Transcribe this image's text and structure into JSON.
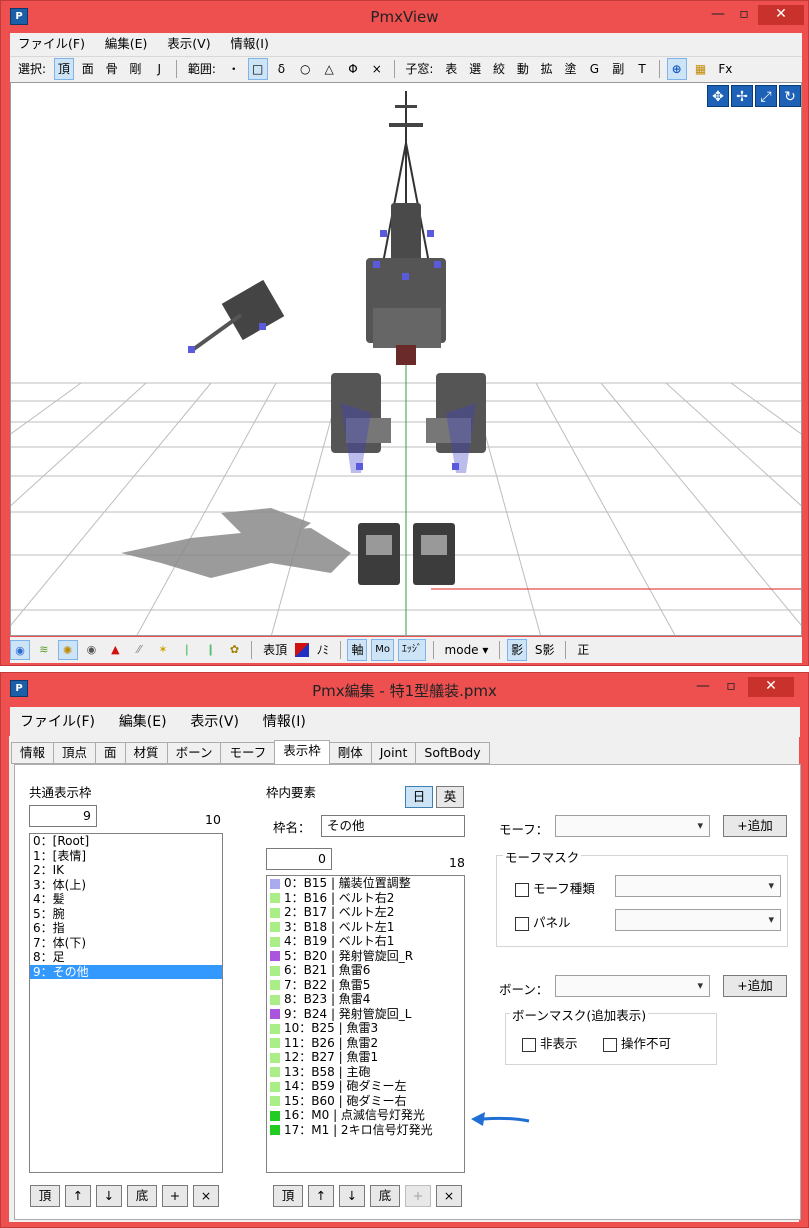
{
  "win1": {
    "title": "PmxView",
    "menu": [
      "ファイル(F)",
      "編集(E)",
      "表示(V)",
      "情報(I)"
    ],
    "toolbar": {
      "select_label": "選択:",
      "select_items": [
        "頂",
        "面",
        "骨",
        "剛",
        "J"
      ],
      "range_label": "範囲:",
      "range_items": [
        "・",
        "□",
        "δ",
        "○",
        "△",
        "Φ",
        "×"
      ],
      "sub_label": "子窓:",
      "sub_items": [
        "表",
        "選",
        "絞",
        "動",
        "拡",
        "塗",
        "G",
        "副",
        "T"
      ],
      "fx": "Fx"
    },
    "bottom": {
      "vertex_label": "表頂",
      "mi_label": "ﾉﾐ",
      "axis_label": "軸",
      "mo_label": "Mo",
      "edge_label": "ｴｯｼﾞ",
      "mode_label": "mode",
      "shadow_label": "影",
      "sshadow_label": "S影",
      "ortho_label": "正"
    }
  },
  "win2": {
    "title": "Pmx編集 - 特1型艤装.pmx",
    "menu": [
      "ファイル(F)",
      "編集(E)",
      "表示(V)",
      "情報(I)"
    ],
    "tabs": [
      "情報",
      "頂点",
      "面",
      "材質",
      "ボーン",
      "モーフ",
      "表示枠",
      "剛体",
      "Joint",
      "SoftBody"
    ],
    "active_tab": "表示枠",
    "left": {
      "label": "共通表示枠",
      "index": "9",
      "count": "10",
      "items": [
        "0：[Root]",
        "1：[表情]",
        "2：IK",
        "3：体(上)",
        "4：髪",
        "5：腕",
        "6：指",
        "7：体(下)",
        "8：足",
        "9：その他"
      ],
      "selected": 9,
      "buttons": [
        "頂",
        "↑",
        "↓",
        "底",
        "+",
        "×"
      ]
    },
    "middle": {
      "label": "枠内要素",
      "lang_jp": "日",
      "lang_en": "英",
      "name_label": "枠名：",
      "name_value": "その他",
      "index": "0",
      "count": "18",
      "items": [
        {
          "text": "0：B15 | 艤装位置調整",
          "color": "#aaaaee"
        },
        {
          "text": "1：B16 | ベルト右2",
          "color": "#aaee88"
        },
        {
          "text": "2：B17 | ベルト左2",
          "color": "#aaee88"
        },
        {
          "text": "3：B18 | ベルト左1",
          "color": "#aaee88"
        },
        {
          "text": "4：B19 | ベルト右1",
          "color": "#aaee88"
        },
        {
          "text": "5：B20 | 発射管旋回_R",
          "color": "#aa55dd"
        },
        {
          "text": "6：B21 | 魚雷6",
          "color": "#aaee88"
        },
        {
          "text": "7：B22 | 魚雷5",
          "color": "#aaee88"
        },
        {
          "text": "8：B23 | 魚雷4",
          "color": "#aaee88"
        },
        {
          "text": "9：B24 | 発射管旋回_L",
          "color": "#aa55dd"
        },
        {
          "text": "10：B25 | 魚雷3",
          "color": "#aaee88"
        },
        {
          "text": "11：B26 | 魚雷2",
          "color": "#aaee88"
        },
        {
          "text": "12：B27 | 魚雷1",
          "color": "#aaee88"
        },
        {
          "text": "13：B58 | 主砲",
          "color": "#aaee88"
        },
        {
          "text": "14：B59 | 砲ダミー左",
          "color": "#aaee88"
        },
        {
          "text": "15：B60 | 砲ダミー右",
          "color": "#aaee88"
        },
        {
          "text": "16：M0 | 点滅信号灯発光",
          "color": "#22cc22"
        },
        {
          "text": "17：M1 | 2キロ信号灯発光",
          "color": "#22cc22"
        }
      ],
      "buttons": [
        "頂",
        "↑",
        "↓",
        "底",
        "+",
        "×"
      ]
    },
    "right": {
      "morph_label": "モーフ：",
      "add1": "+追加",
      "morph_mask": "モーフマスク",
      "cb1": "モーフ種類",
      "cb2": "パネル",
      "bone_label": "ボーン：",
      "add2": "+追加",
      "bone_mask": "ボーンマスク(追加表示)",
      "cb3": "非表示",
      "cb4": "操作不可"
    }
  }
}
